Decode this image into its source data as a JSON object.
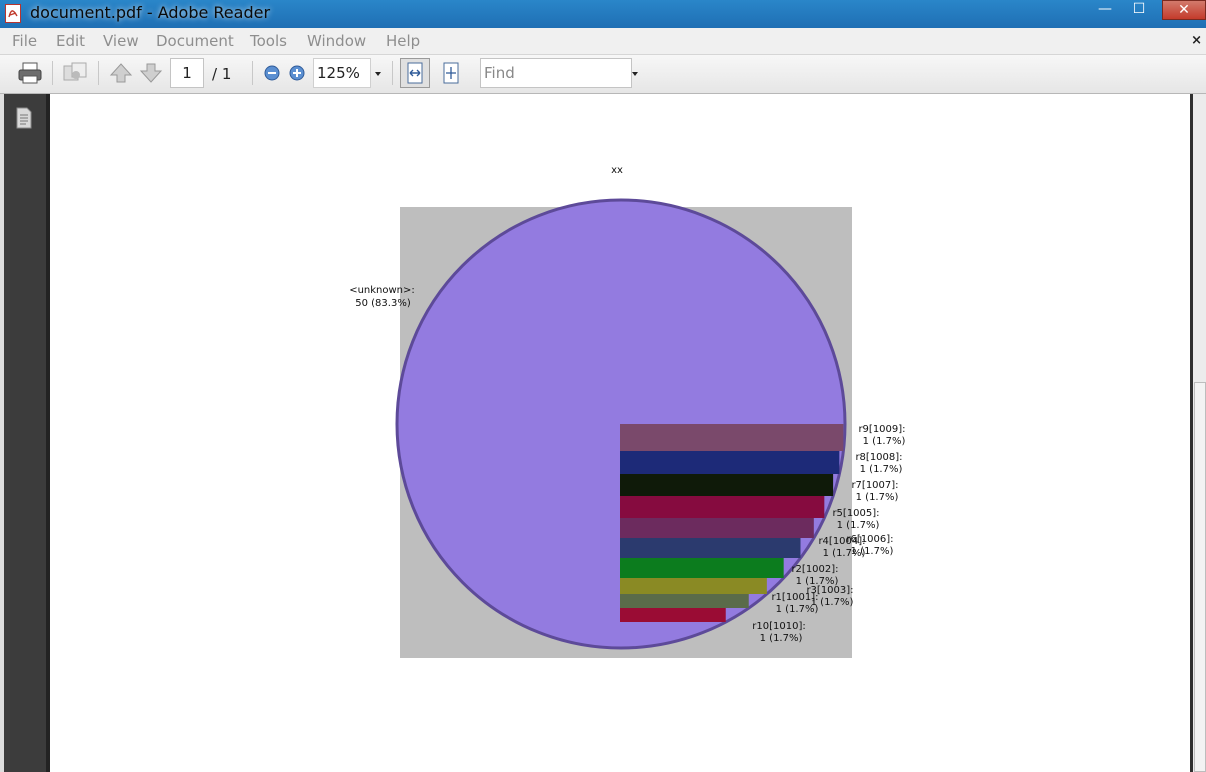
{
  "window": {
    "title": "document.pdf - Adobe Reader",
    "controls": {
      "minimize": "—",
      "maximize": "☐",
      "close": "✕"
    }
  },
  "menu": {
    "items": [
      "File",
      "Edit",
      "View",
      "Document",
      "Tools",
      "Window",
      "Help"
    ],
    "close_doc": "×"
  },
  "toolbar": {
    "page_current": "1",
    "page_total": "/ 1",
    "zoom": "125%",
    "find_placeholder": "Find"
  },
  "colors": {
    "titlebar": "#2a86c9",
    "panel": "#3c3c3c",
    "plot_bg": "#bebebe"
  },
  "chart_data": {
    "type": "pie",
    "title": "xx",
    "slices": [
      {
        "label": "<unknown>:",
        "value": 50,
        "percent": "83.3%",
        "color": "#937be0",
        "edge": "#5d4a99"
      },
      {
        "label": "r9[1009]:",
        "value": 1,
        "percent": "1.7%",
        "color": "#7a496b"
      },
      {
        "label": "r8[1008]:",
        "value": 1,
        "percent": "1.7%",
        "color": "#1d2a78"
      },
      {
        "label": "r7[1007]:",
        "value": 1,
        "percent": "1.7%",
        "color": "#0f1a09"
      },
      {
        "label": "r5[1005]:",
        "value": 1,
        "percent": "1.7%",
        "color": "#860b3f"
      },
      {
        "label": "r6[1006]:",
        "value": 1,
        "percent": "1.7%",
        "color": "#6c2b5e"
      },
      {
        "label": "r4[1004]:",
        "value": 1,
        "percent": "1.7%",
        "color": "#2b3a6e"
      },
      {
        "label": "r2[1002]:",
        "value": 1,
        "percent": "1.7%",
        "color": "#0c7c1e"
      },
      {
        "label": "r3[1003]:",
        "value": 1,
        "percent": "1.7%",
        "color": "#8a8a24"
      },
      {
        "label": "r1[1001]:",
        "value": 1,
        "percent": "1.7%",
        "color": "#5a6b4a"
      },
      {
        "label": "r10[1010]:",
        "value": 1,
        "percent": "1.7%",
        "color": "#9a0c34"
      }
    ]
  }
}
